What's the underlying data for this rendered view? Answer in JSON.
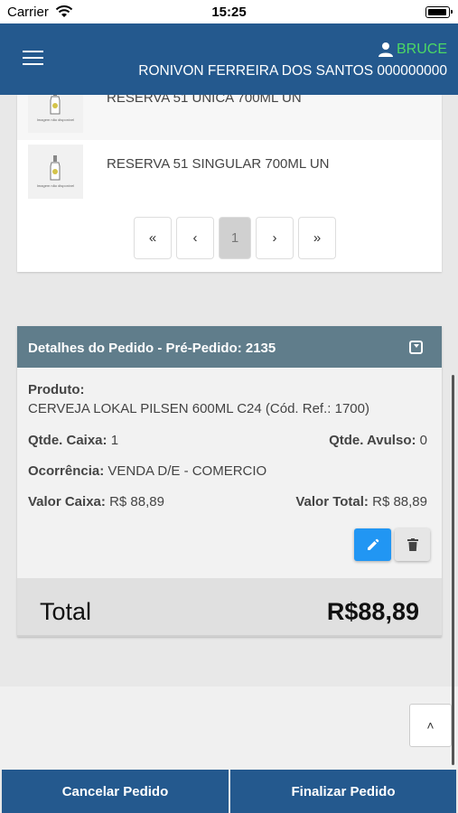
{
  "status_bar": {
    "carrier": "Carrier",
    "time": "15:25"
  },
  "header": {
    "user_name": "BRUCE",
    "client_name": "RONIVON FERREIRA DOS SANTOS 000000000",
    "accent_color": "#4cd964",
    "bar_color": "#24598e"
  },
  "products": {
    "items": [
      {
        "name": "RESERVA 51 ÚNICA 700ML UN",
        "image_caption": "Imagem não disponível"
      },
      {
        "name": "RESERVA 51 SINGULAR 700ML UN",
        "image_caption": "Imagem não disponível"
      }
    ],
    "pagination": {
      "first": "«",
      "prev": "‹",
      "current": "1",
      "next": "›",
      "last": "»"
    }
  },
  "order_details": {
    "title": "Detalhes do Pedido - Pré-Pedido: 2135",
    "product_label": "Produto:",
    "product_value": "CERVEJA LOKAL PILSEN 600ML C24 (Cód. Ref.: 1700)",
    "qty_box_label": "Qtde. Caixa:",
    "qty_box_value": "1",
    "qty_loose_label": "Qtde. Avulso:",
    "qty_loose_value": "0",
    "occurrence_label": "Ocorrência:",
    "occurrence_value": "VENDA D/E - COMERCIO",
    "box_value_label": "Valor Caixa:",
    "box_value_value": "R$ 88,89",
    "total_value_label": "Valor Total:",
    "total_value_value": "R$ 88,89"
  },
  "total": {
    "label": "Total",
    "value": "R$88,89"
  },
  "scroll_top_label": "˄",
  "actions": {
    "cancel": "Cancelar Pedido",
    "finish": "Finalizar Pedido"
  },
  "icons": [
    "wifi-icon",
    "battery-icon",
    "menu-icon",
    "user-icon",
    "bottle-icon",
    "collapse-icon",
    "edit-icon",
    "delete-icon",
    "chevron-up-icon"
  ]
}
